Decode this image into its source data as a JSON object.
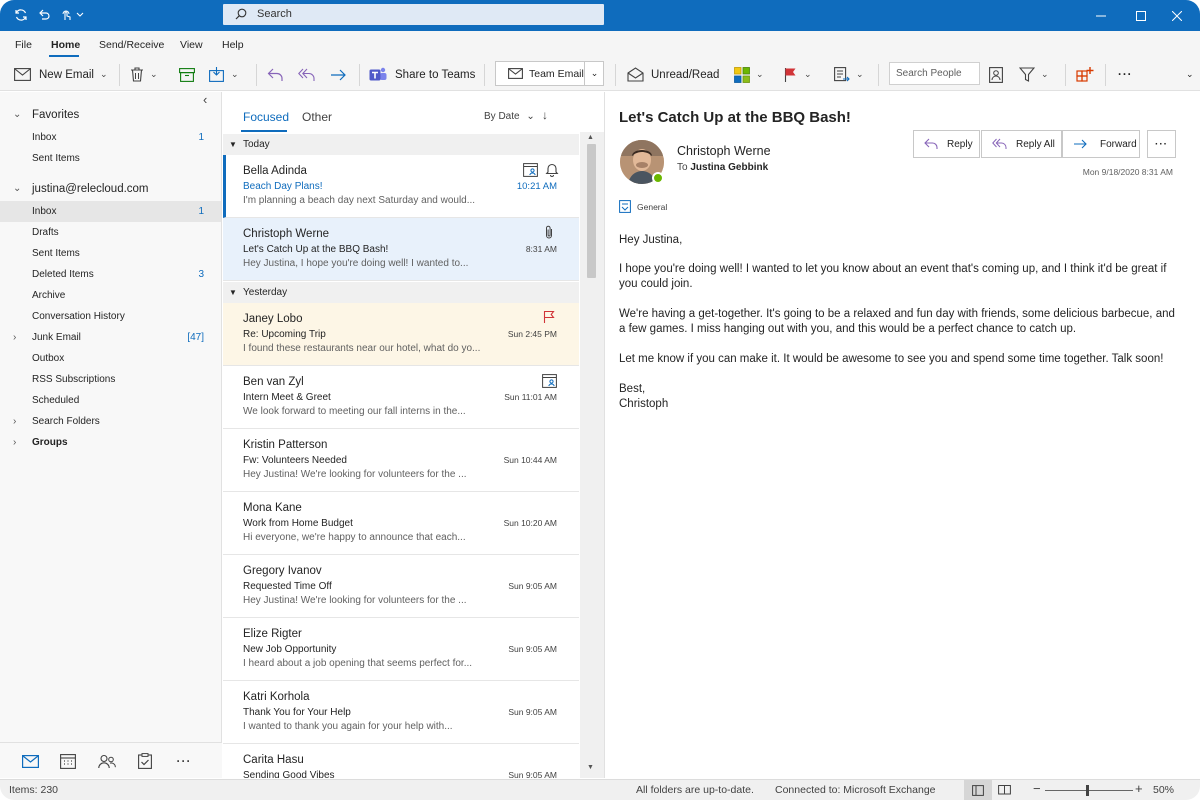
{
  "search": {
    "placeholder": "Search"
  },
  "menu": [
    "File",
    "Home",
    "Send/Receive",
    "View",
    "Help"
  ],
  "ribbon": {
    "new_email": "New Email",
    "share_to_teams": "Share to Teams",
    "team_email": "Team Email",
    "unread_read": "Unread/Read",
    "search_people": "Search People"
  },
  "nav": {
    "favorites_label": "Favorites",
    "favorites": [
      {
        "label": "Inbox",
        "count": "1"
      },
      {
        "label": "Sent Items",
        "count": ""
      }
    ],
    "account": "justina@relecloud.com",
    "folders": [
      {
        "label": "Inbox",
        "count": "1"
      },
      {
        "label": "Drafts",
        "count": ""
      },
      {
        "label": "Sent Items",
        "count": ""
      },
      {
        "label": "Deleted Items",
        "count": "3"
      },
      {
        "label": "Archive",
        "count": ""
      },
      {
        "label": "Conversation History",
        "count": ""
      },
      {
        "label": "Junk Email",
        "count": "[47]"
      },
      {
        "label": "Outbox",
        "count": ""
      },
      {
        "label": "RSS Subscriptions",
        "count": ""
      },
      {
        "label": "Scheduled",
        "count": ""
      },
      {
        "label": "Search Folders",
        "count": ""
      },
      {
        "label": "Groups",
        "count": ""
      }
    ]
  },
  "list": {
    "tab_focused": "Focused",
    "tab_other": "Other",
    "sort": "By Date",
    "group_today": "Today",
    "group_yesterday": "Yesterday",
    "messages": [
      {
        "from": "Bella Adinda",
        "subject": "Beach Day Plans!",
        "preview": "I'm planning a beach day next Saturday and would...",
        "time": "10:21 AM"
      },
      {
        "from": "Christoph Werne",
        "subject": "Let's Catch Up at the BBQ Bash!",
        "preview": "Hey Justina, I hope you're doing well! I wanted to...",
        "time": "8:31 AM"
      },
      {
        "from": "Janey Lobo",
        "subject": "Re: Upcoming Trip",
        "preview": "I found these restaurants near our hotel, what do yo...",
        "time": "Sun 2:45 PM"
      },
      {
        "from": "Ben van Zyl",
        "subject": "Intern Meet & Greet",
        "preview": "We look forward to meeting our fall interns in the...",
        "time": "Sun 11:01 AM"
      },
      {
        "from": "Kristin Patterson",
        "subject": "Fw: Volunteers Needed",
        "preview": "Hey Justina! We're looking for volunteers for the ...",
        "time": "Sun 10:44 AM"
      },
      {
        "from": "Mona Kane",
        "subject": "Work from Home Budget",
        "preview": "Hi everyone, we're happy to announce that each...",
        "time": "Sun 10:20 AM"
      },
      {
        "from": "Gregory Ivanov",
        "subject": "Requested Time Off",
        "preview": "Hey Justina! We're looking for volunteers for the ...",
        "time": "Sun 9:05 AM"
      },
      {
        "from": "Elize Rigter",
        "subject": "New Job Opportunity",
        "preview": " I heard about a job opening that seems perfect for...",
        "time": "Sun 9:05 AM"
      },
      {
        "from": "Katri Korhola",
        "subject": "Thank You for Your Help",
        "preview": "I wanted to thank you again for your help with...",
        "time": "Sun 9:05 AM"
      },
      {
        "from": "Carita Hasu",
        "subject": "Sending Good Vibes",
        "preview": "",
        "time": "Sun 9:05 AM"
      }
    ]
  },
  "reading": {
    "subject": "Let's Catch Up at the BBQ Bash!",
    "from": "Christoph Werne",
    "to_prefix": "To",
    "to": "Justina Gebbink",
    "reply": "Reply",
    "reply_all": "Reply All",
    "forward": "Forward",
    "date": "Mon 9/18/2020 8:31 AM",
    "tag": "General",
    "body": [
      "Hey Justina,",
      "I hope you're doing well! I wanted to let you know about an event that's coming up, and I think it'd be great if you could join.",
      "We're having a get-together. It's going to be a relaxed and fun day with friends, some delicious barbecue, and a few games. I miss hanging out with you, and this would be a perfect chance to catch up.",
      "Let me know if you can make it. It would be awesome to see you and spend some time together. Talk soon!",
      "Best,",
      "Christoph"
    ]
  },
  "status": {
    "items": "Items: 230",
    "sync": "All folders are up-to-date.",
    "connection": "Connected to: Microsoft Exchange",
    "zoom": "50%"
  },
  "colors": {
    "accent": "#0f6cbd",
    "flag": "#d13438",
    "presence": "#6bb700"
  }
}
